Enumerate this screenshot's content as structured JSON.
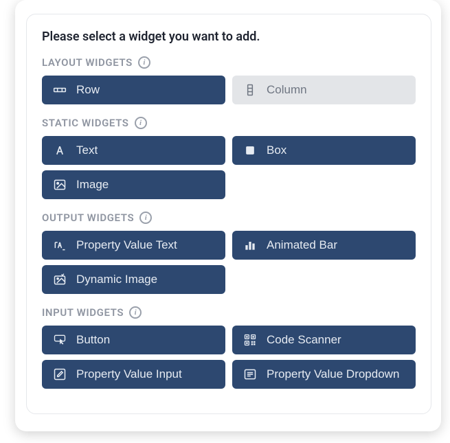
{
  "title": "Please select a widget you want to add.",
  "sections": {
    "layout": {
      "label": "LAYOUT WIDGETS",
      "row": "Row",
      "column": "Column"
    },
    "static": {
      "label": "STATIC WIDGETS",
      "text": "Text",
      "box": "Box",
      "image": "Image"
    },
    "output": {
      "label": "OUTPUT WIDGETS",
      "propertyValueText": "Property Value Text",
      "animatedBar": "Animated Bar",
      "dynamicImage": "Dynamic Image"
    },
    "input": {
      "label": "INPUT WIDGETS",
      "button": "Button",
      "codeScanner": "Code Scanner",
      "propertyValueInput": "Property Value Input",
      "propertyValueDropdown": "Property Value Dropdown"
    }
  }
}
